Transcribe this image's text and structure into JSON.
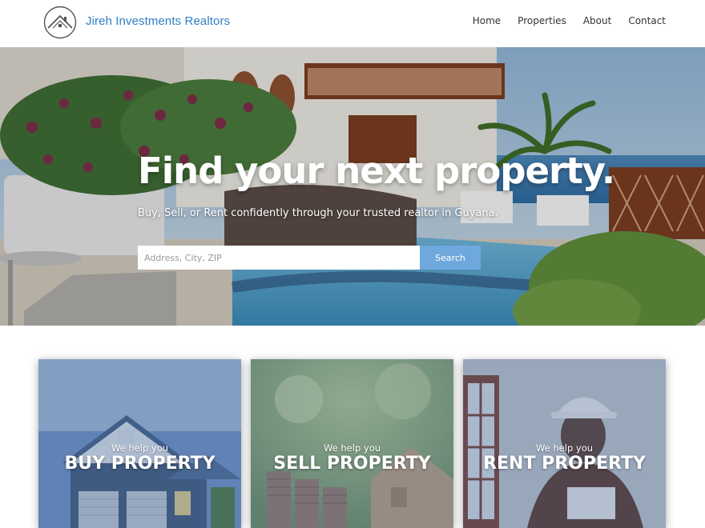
{
  "header": {
    "brand": "Jireh Investments Realtors",
    "logo_icon": "house-roof-circle-icon",
    "nav": [
      "Home",
      "Properties",
      "About",
      "Contact"
    ]
  },
  "hero": {
    "title": "Find your next property.",
    "subtitle": "Buy, Sell, or Rent confidently through your trusted realtor in Guyana.",
    "search_placeholder": "Address, City, ZIP",
    "search_button": "Search"
  },
  "services": [
    {
      "small": "We help you",
      "big": "BUY PROPERTY"
    },
    {
      "small": "We help you",
      "big": "SELL PROPERTY"
    },
    {
      "small": "We help you",
      "big": "RENT PROPERTY"
    }
  ],
  "colors": {
    "brand": "#2f7fc6",
    "search_button": "#6fa8dc",
    "nav_text": "#333333"
  }
}
